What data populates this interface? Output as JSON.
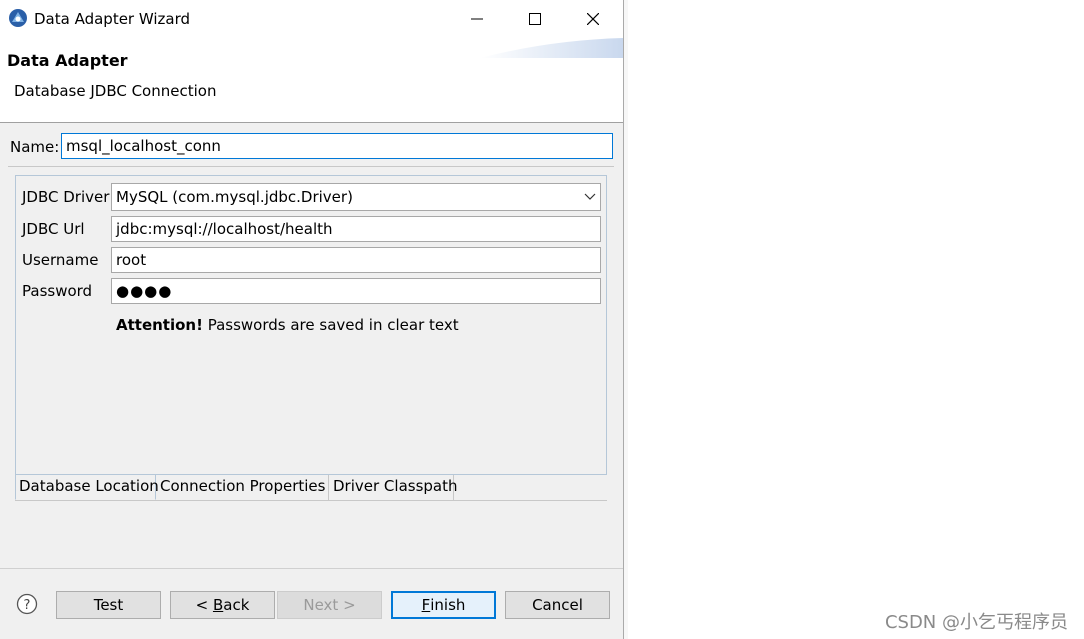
{
  "window": {
    "title": "Data Adapter Wizard",
    "icons": {
      "app": "data-adapter-icon",
      "minimize": "minimize-icon",
      "maximize": "maximize-icon",
      "close": "close-icon"
    }
  },
  "header": {
    "heading": "Data Adapter",
    "description": "Database JDBC Connection"
  },
  "name_field": {
    "label": "Name:",
    "value": "msql_localhost_conn"
  },
  "connection": {
    "driver_label": "JDBC Driver",
    "driver_value": "MySQL (com.mysql.jdbc.Driver)",
    "url_label": "JDBC Url",
    "url_value": "jdbc:mysql://localhost/health",
    "username_label": "Username",
    "username_value": "root",
    "password_label": "Password",
    "password_value": "●●●●",
    "attention_strong": "Attention!",
    "attention_text": " Passwords are saved in clear text"
  },
  "tabs": [
    {
      "label": "Database Location",
      "selected": true
    },
    {
      "label": "Connection Properties",
      "selected": false
    },
    {
      "label": "Driver Classpath",
      "selected": false
    }
  ],
  "buttons": {
    "help_icon": "help-icon",
    "test": "Test",
    "back_prefix": "< ",
    "back_mnemonic": "B",
    "back_rest": "ack",
    "next": "Next >",
    "finish_mnemonic": "F",
    "finish_rest": "inish",
    "cancel": "Cancel"
  },
  "watermark": "CSDN @小乞丐程序员",
  "colors": {
    "accent": "#0078d7",
    "dialog_bg": "#f0f0f0"
  }
}
